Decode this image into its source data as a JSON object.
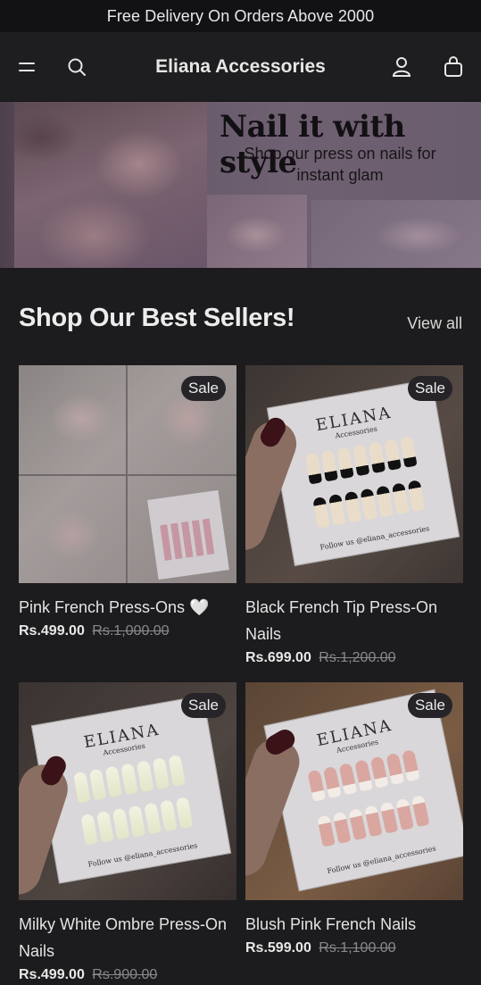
{
  "announcement": "Free Delivery On Orders Above 2000",
  "header": {
    "brand": "Eliana Accessories",
    "icons": [
      "menu-icon",
      "search-icon",
      "account-icon",
      "cart-icon"
    ]
  },
  "hero": {
    "title": "Nail it with style",
    "subtitle": "Shop our press on nails for instant glam"
  },
  "section": {
    "title": "Shop Our Best Sellers!",
    "view_all": "View all"
  },
  "products": [
    {
      "name": "Pink French Press-Ons 🤍",
      "price": "Rs.499.00",
      "old_price": "Rs.1,000.00",
      "badge": "Sale"
    },
    {
      "name": "Black French Tip Press-On Nails",
      "price": "Rs.699.00",
      "old_price": "Rs.1,200.00",
      "badge": "Sale"
    },
    {
      "name": "Milky White Ombre Press-On Nails",
      "price": "Rs.499.00",
      "old_price": "Rs.900.00",
      "badge": "Sale"
    },
    {
      "name": "Blush Pink French Nails",
      "price": "Rs.599.00",
      "old_price": "Rs.1,100.00",
      "badge": "Sale"
    }
  ],
  "packaging": {
    "logo": "ELIANA",
    "logo_sub": "Accessories",
    "follow": "Follow us @eliana_accessories"
  },
  "colors": {
    "background": "#1c1b1d",
    "announcement_bg": "#121113",
    "badge_bg": "#262428"
  }
}
